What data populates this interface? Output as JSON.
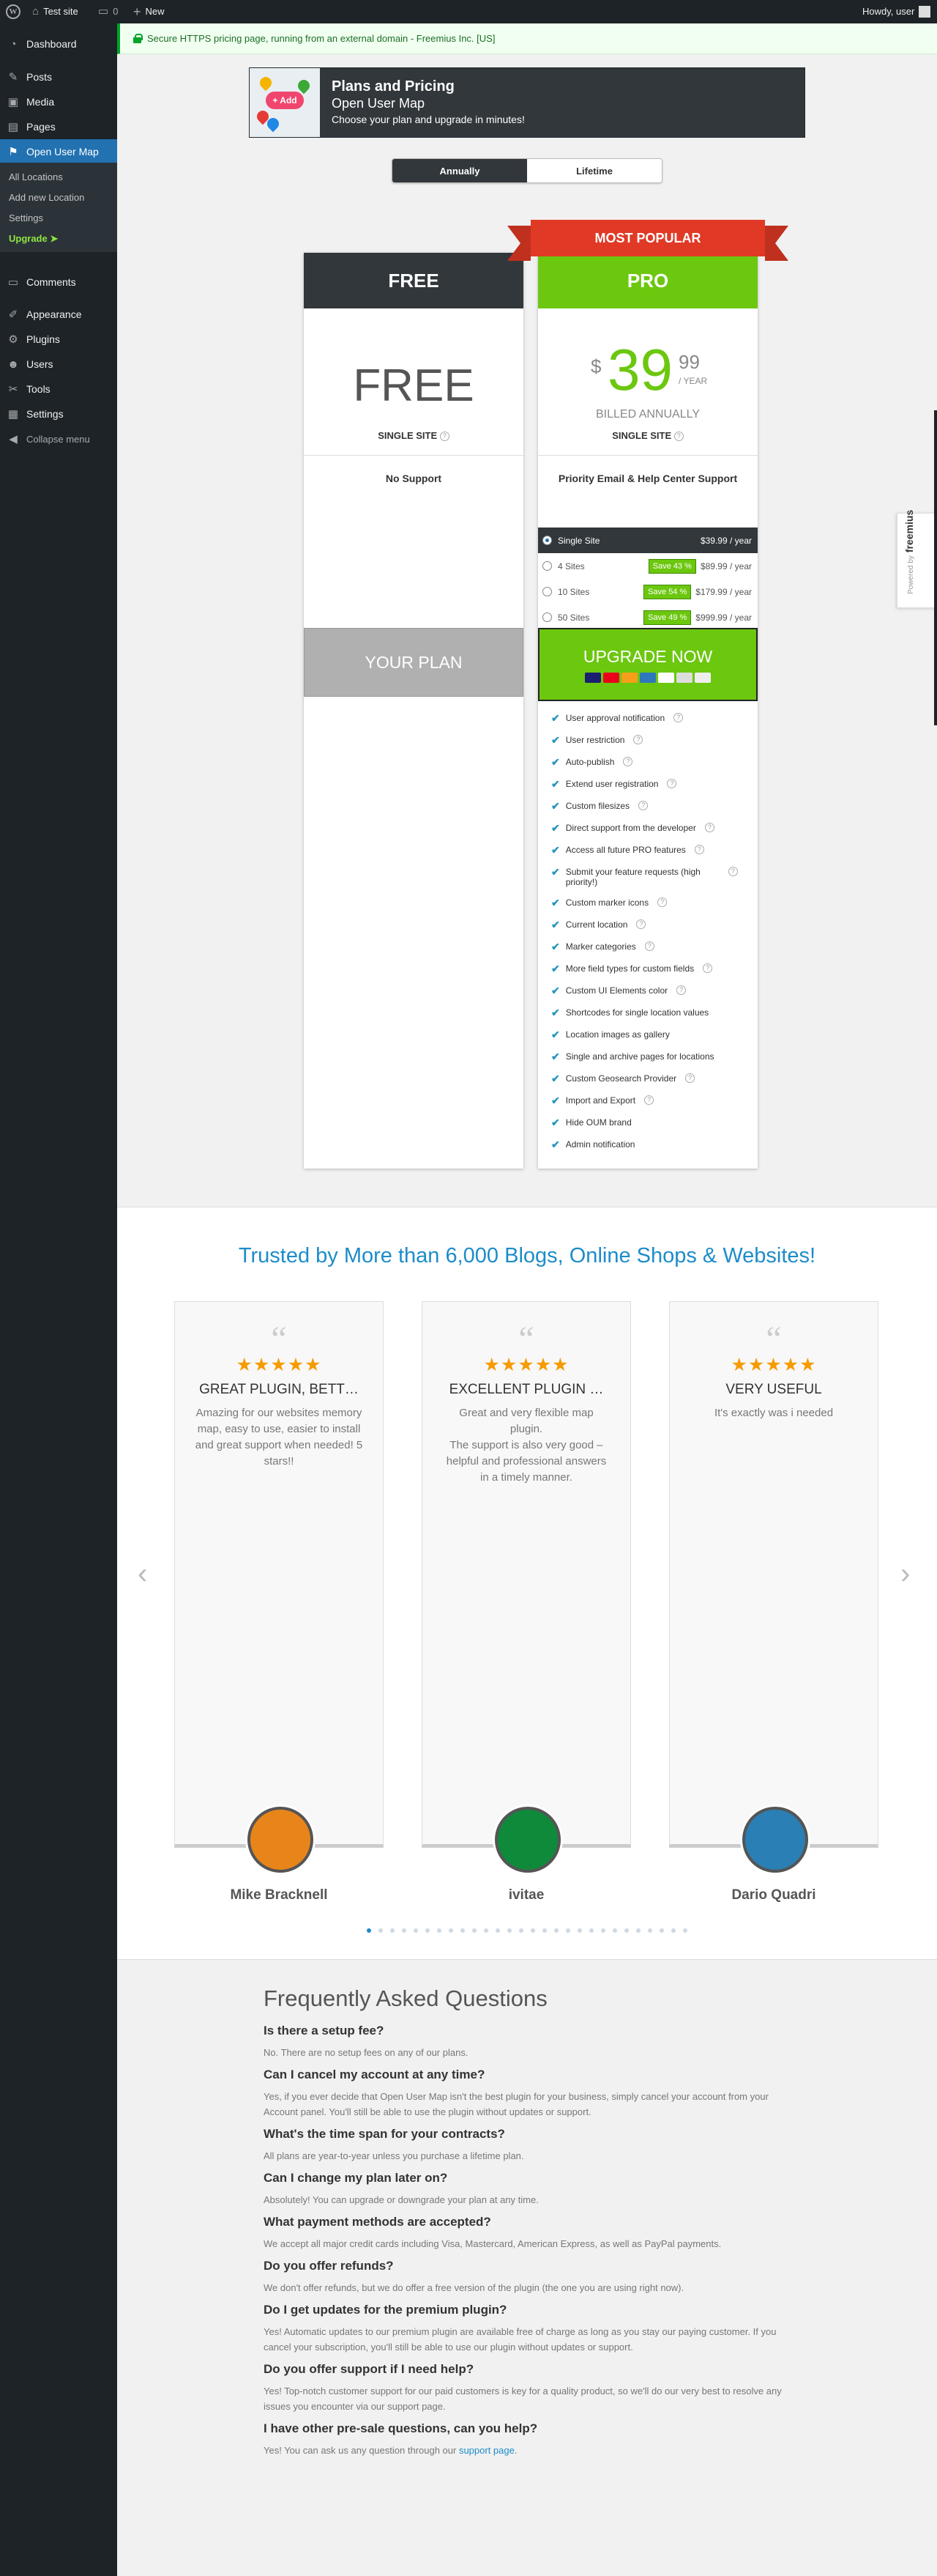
{
  "adminbar": {
    "site_name": "Test site",
    "comments_count": "0",
    "new_label": "New",
    "howdy": "Howdy, user"
  },
  "sidebar": {
    "items": [
      {
        "label": "Dashboard",
        "icon": "dashboard-icon"
      },
      {
        "label": "Posts",
        "icon": "pin-icon"
      },
      {
        "label": "Media",
        "icon": "media-icon"
      },
      {
        "label": "Pages",
        "icon": "pages-icon"
      },
      {
        "label": "Open User Map",
        "icon": "map-icon"
      },
      {
        "label": "Comments",
        "icon": "comment-icon"
      },
      {
        "label": "Appearance",
        "icon": "brush-icon"
      },
      {
        "label": "Plugins",
        "icon": "plug-icon"
      },
      {
        "label": "Users",
        "icon": "user-icon"
      },
      {
        "label": "Tools",
        "icon": "wrench-icon"
      },
      {
        "label": "Settings",
        "icon": "settings-icon"
      },
      {
        "label": "Collapse menu",
        "icon": "collapse-icon"
      }
    ],
    "submenu": [
      "All Locations",
      "Add new Location",
      "Settings",
      "Upgrade ➤"
    ]
  },
  "notice": "Secure HTTPS pricing page, running from an external domain - Freemius Inc. [US]",
  "header": {
    "title": "Plans and Pricing",
    "plugin": "Open User Map",
    "desc": "Choose your plan and upgrade in minutes!"
  },
  "billing": {
    "annually": "Annually",
    "lifetime": "Lifetime",
    "selected": "Annually"
  },
  "plans": {
    "free": {
      "name": "FREE",
      "price_text": "FREE",
      "sites": "SINGLE SITE",
      "support": "No Support",
      "cta": "YOUR PLAN"
    },
    "pro": {
      "ribbon": "MOST POPULAR",
      "name": "PRO",
      "currency": "$",
      "price_int": "39",
      "price_dec": "99",
      "period": "/ YEAR",
      "billed": "BILLED ANNUALLY",
      "sites": "SINGLE SITE",
      "support": "Priority Email & Help Center Support",
      "licenses": [
        {
          "name": "Single Site",
          "save": "",
          "price": "$39.99 / year",
          "selected": true
        },
        {
          "name": "4 Sites",
          "save": "Save 43 %",
          "price": "$89.99 / year",
          "selected": false
        },
        {
          "name": "10 Sites",
          "save": "Save 54 %",
          "price": "$179.99 / year",
          "selected": false
        },
        {
          "name": "50 Sites",
          "save": "Save 49 %",
          "price": "$999.99 / year",
          "selected": false
        }
      ],
      "cta": "UPGRADE NOW",
      "features": [
        {
          "text": "User approval notification",
          "help": true
        },
        {
          "text": "User restriction",
          "help": true
        },
        {
          "text": "Auto-publish",
          "help": true
        },
        {
          "text": "Extend user registration",
          "help": true
        },
        {
          "text": "Custom filesizes",
          "help": true
        },
        {
          "text": "Direct support from the developer",
          "help": true
        },
        {
          "text": "Access all future PRO features",
          "help": true
        },
        {
          "text": "Submit your feature requests (high priority!)",
          "help": true
        },
        {
          "text": "Custom marker icons",
          "help": true
        },
        {
          "text": "Current location",
          "help": true
        },
        {
          "text": "Marker categories",
          "help": true
        },
        {
          "text": "More field types for custom fields",
          "help": true
        },
        {
          "text": "Custom UI Elements color",
          "help": true
        },
        {
          "text": "Shortcodes for single location values",
          "help": false
        },
        {
          "text": "Location images as gallery",
          "help": false
        },
        {
          "text": "Single and archive pages for locations",
          "help": false
        },
        {
          "text": "Custom Geosearch Provider",
          "help": true
        },
        {
          "text": "Import and Export",
          "help": true
        },
        {
          "text": "Hide OUM brand",
          "help": false
        },
        {
          "text": "Admin notification",
          "help": false
        }
      ]
    }
  },
  "testimonials": {
    "heading": "Trusted by More than 6,000 Blogs, Online Shops & Websites!",
    "items": [
      {
        "title": "GREAT PLUGIN, BETT…",
        "body": "Amazing for our websites memory map, easy to use, easier to install and great support when needed! 5 stars!!",
        "name": "Mike Bracknell",
        "rating": 5,
        "avatar_color": "#e8851a"
      },
      {
        "title": "EXCELLENT PLUGIN …",
        "body": "Great and very flexible map plugin.\nThe support is also very good – helpful and professional answers in a timely manner.",
        "name": "ivitae",
        "rating": 5,
        "avatar_color": "#0f8a3a"
      },
      {
        "title": "VERY USEFUL",
        "body": "It's exactly was i needed",
        "name": "Dario Quadri",
        "rating": 5,
        "avatar_color": "#2a7fb5"
      }
    ],
    "dots_total": 28,
    "dots_active": 1
  },
  "faq": {
    "heading": "Frequently Asked Questions",
    "items": [
      {
        "q": "Is there a setup fee?",
        "a": "No. There are no setup fees on any of our plans."
      },
      {
        "q": "Can I cancel my account at any time?",
        "a": "Yes, if you ever decide that Open User Map isn't the best plugin for your business, simply cancel your account from your Account panel. You'll still be able to use the plugin without updates or support."
      },
      {
        "q": "What's the time span for your contracts?",
        "a": "All plans are year-to-year unless you purchase a lifetime plan."
      },
      {
        "q": "Can I change my plan later on?",
        "a": "Absolutely! You can upgrade or downgrade your plan at any time."
      },
      {
        "q": "What payment methods are accepted?",
        "a": "We accept all major credit cards including Visa, Mastercard, American Express, as well as PayPal payments."
      },
      {
        "q": "Do you offer refunds?",
        "a": "We don't offer refunds, but we do offer a free version of the plugin (the one you are using right now)."
      },
      {
        "q": "Do I get updates for the premium plugin?",
        "a": "Yes! Automatic updates to our premium plugin are available free of charge as long as you stay our paying customer. If you cancel your subscription, you'll still be able to use our plugin without updates or support."
      },
      {
        "q": "Do you offer support if I need help?",
        "a": "Yes! Top-notch customer support for our paid customers is key for a quality product, so we'll do our very best to resolve any issues you encounter via our support page."
      },
      {
        "q": "I have other pre-sale questions, can you help?",
        "a": "Yes! You can ask us any question through our",
        "link": "support page",
        "after": "."
      }
    ]
  },
  "freemius": {
    "powered": "Powered by",
    "brand": "freemius"
  }
}
